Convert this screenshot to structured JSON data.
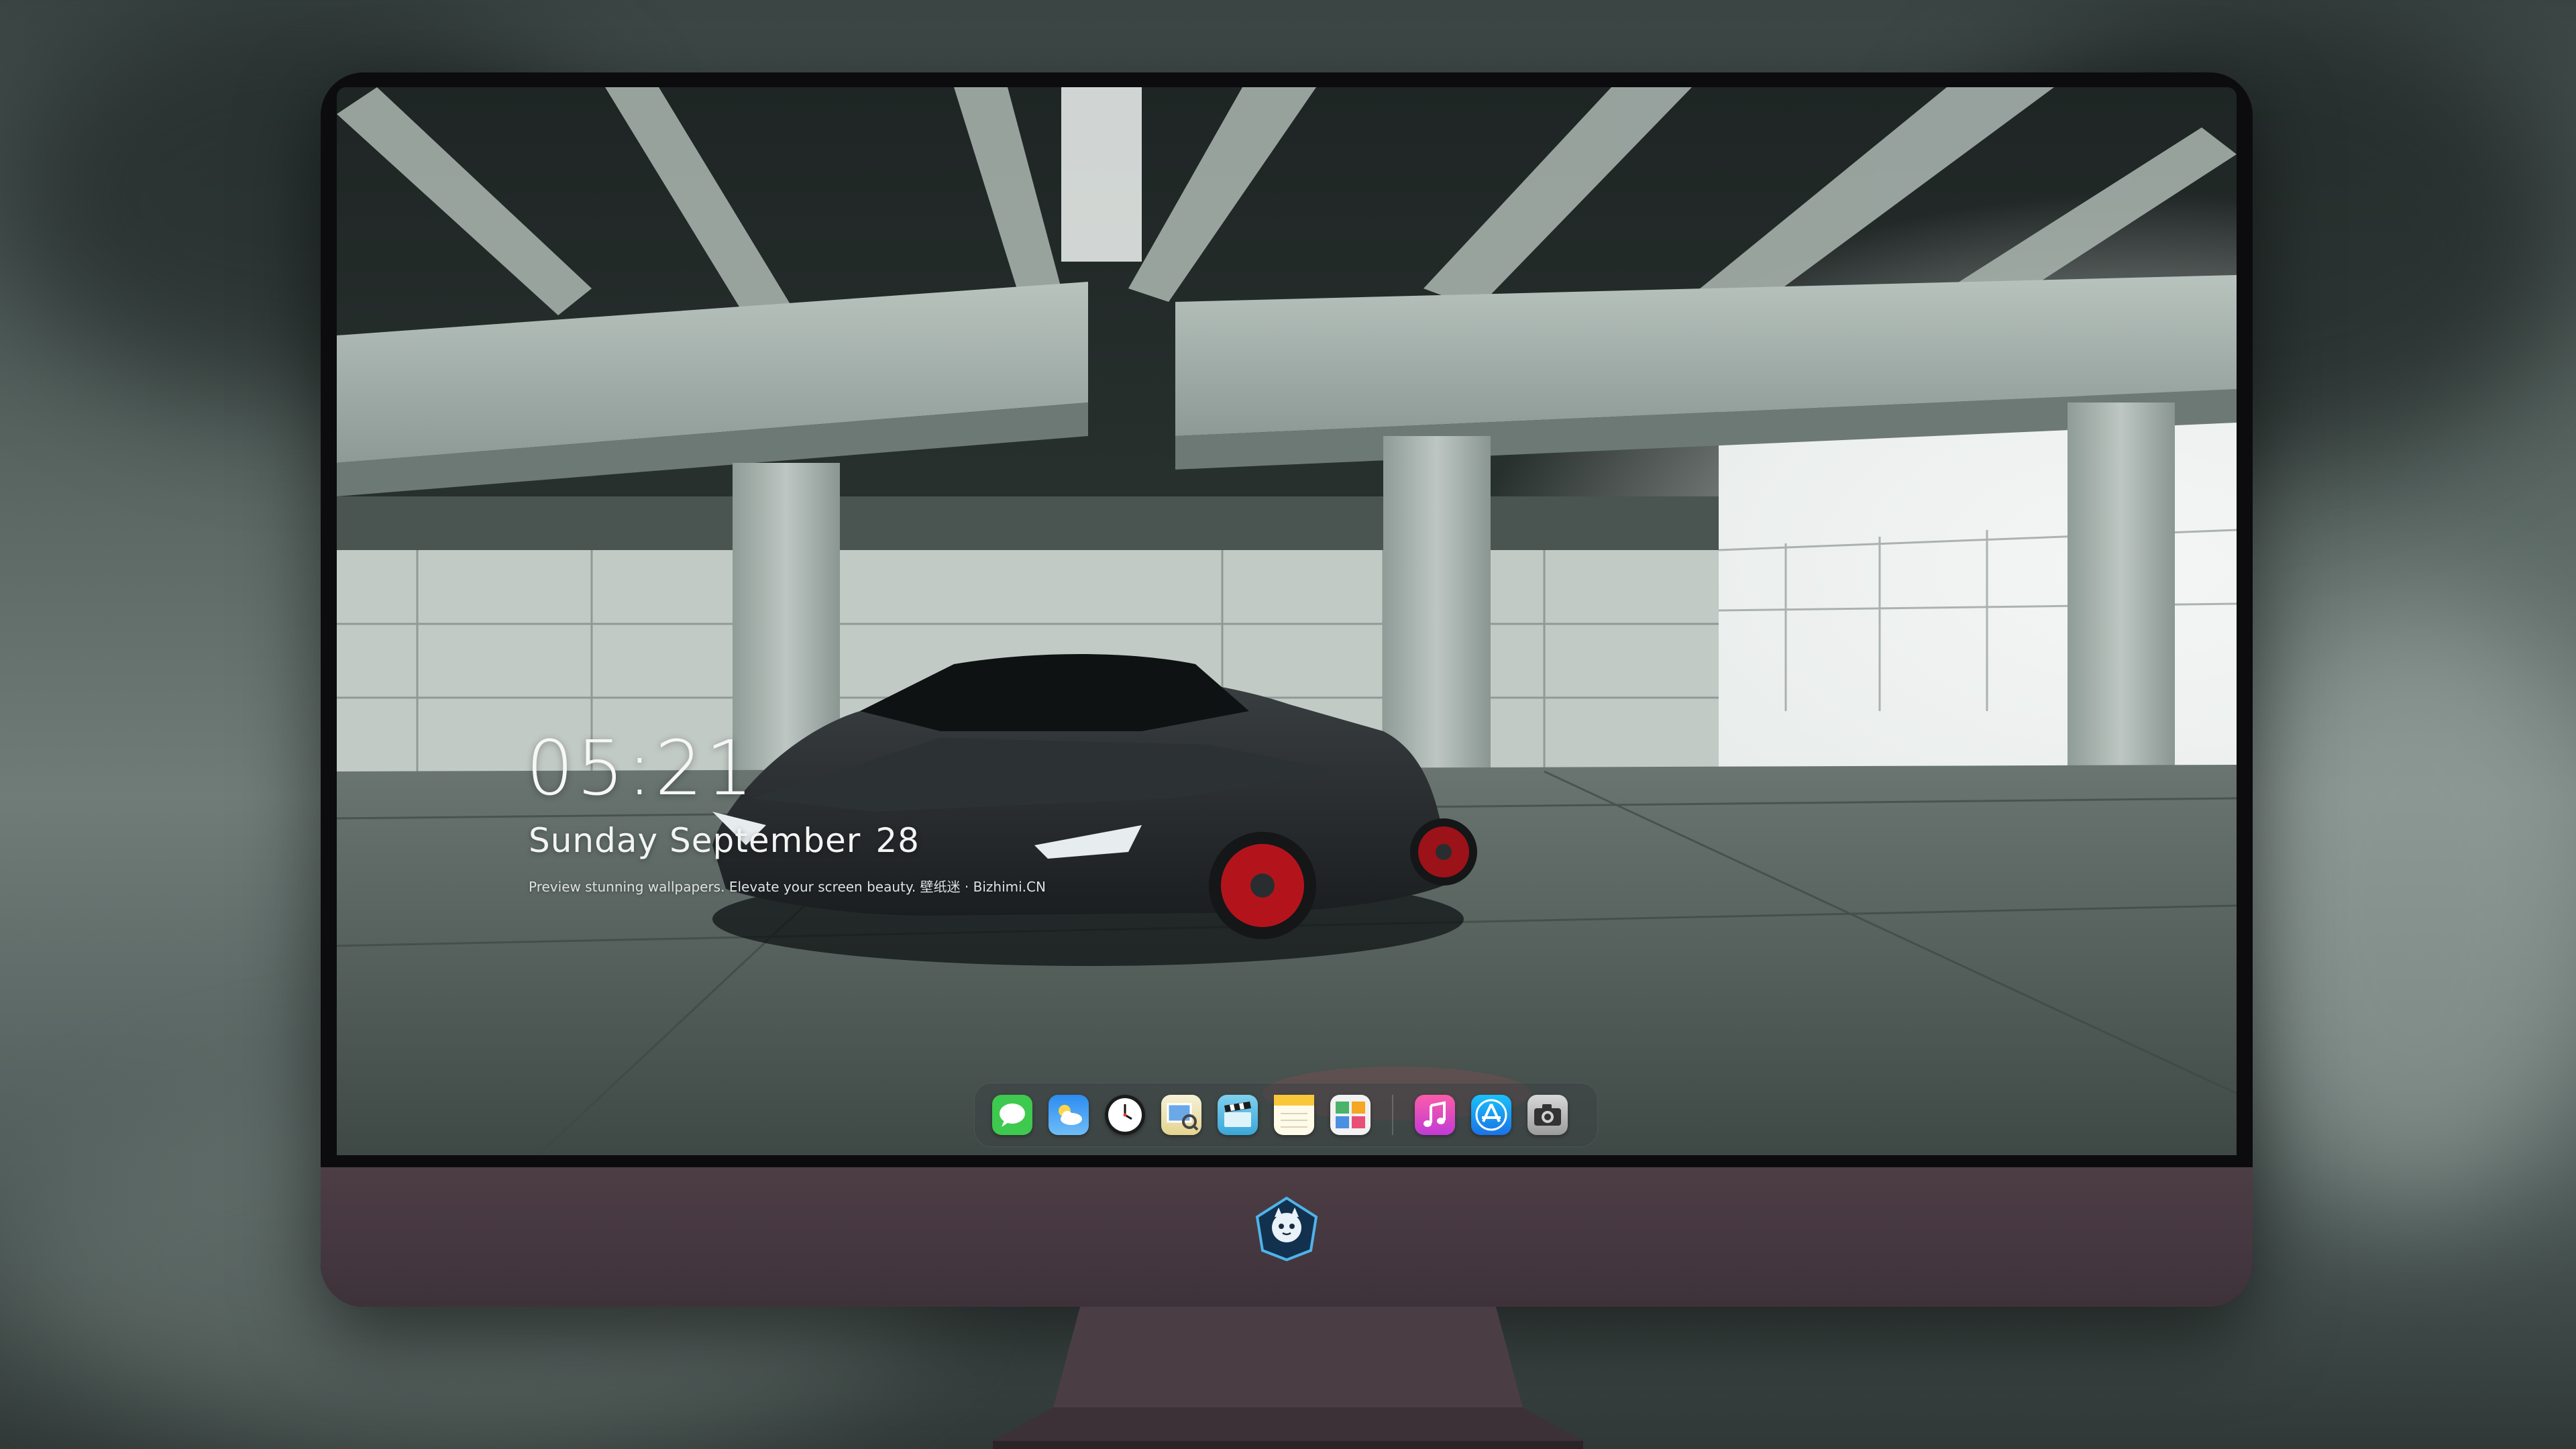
{
  "lockscreen": {
    "time": "05:21",
    "weekday_month": "Sunday September",
    "day": "28",
    "tagline": "Preview stunning wallpapers. Elevate your screen beauty. 壁纸迷 · Bizhimi.CN"
  },
  "dock": {
    "apps": [
      {
        "name": "Messages",
        "icon": "messages-icon"
      },
      {
        "name": "Weather",
        "icon": "weather-icon"
      },
      {
        "name": "Clock",
        "icon": "clock-icon"
      },
      {
        "name": "Preview",
        "icon": "preview-icon"
      },
      {
        "name": "Clips",
        "icon": "clapperboard-icon"
      },
      {
        "name": "Notes",
        "icon": "notes-icon"
      },
      {
        "name": "Photo Booth",
        "icon": "photo-booth-icon"
      },
      {
        "name": "Music",
        "icon": "music-icon"
      },
      {
        "name": "App Store",
        "icon": "app-store-icon"
      },
      {
        "name": "Camera",
        "icon": "camera-icon"
      }
    ]
  },
  "colors": {
    "wheel_accent": "#b3141c",
    "dock_background": "#3c4244",
    "monitor_chin": "#463840"
  }
}
